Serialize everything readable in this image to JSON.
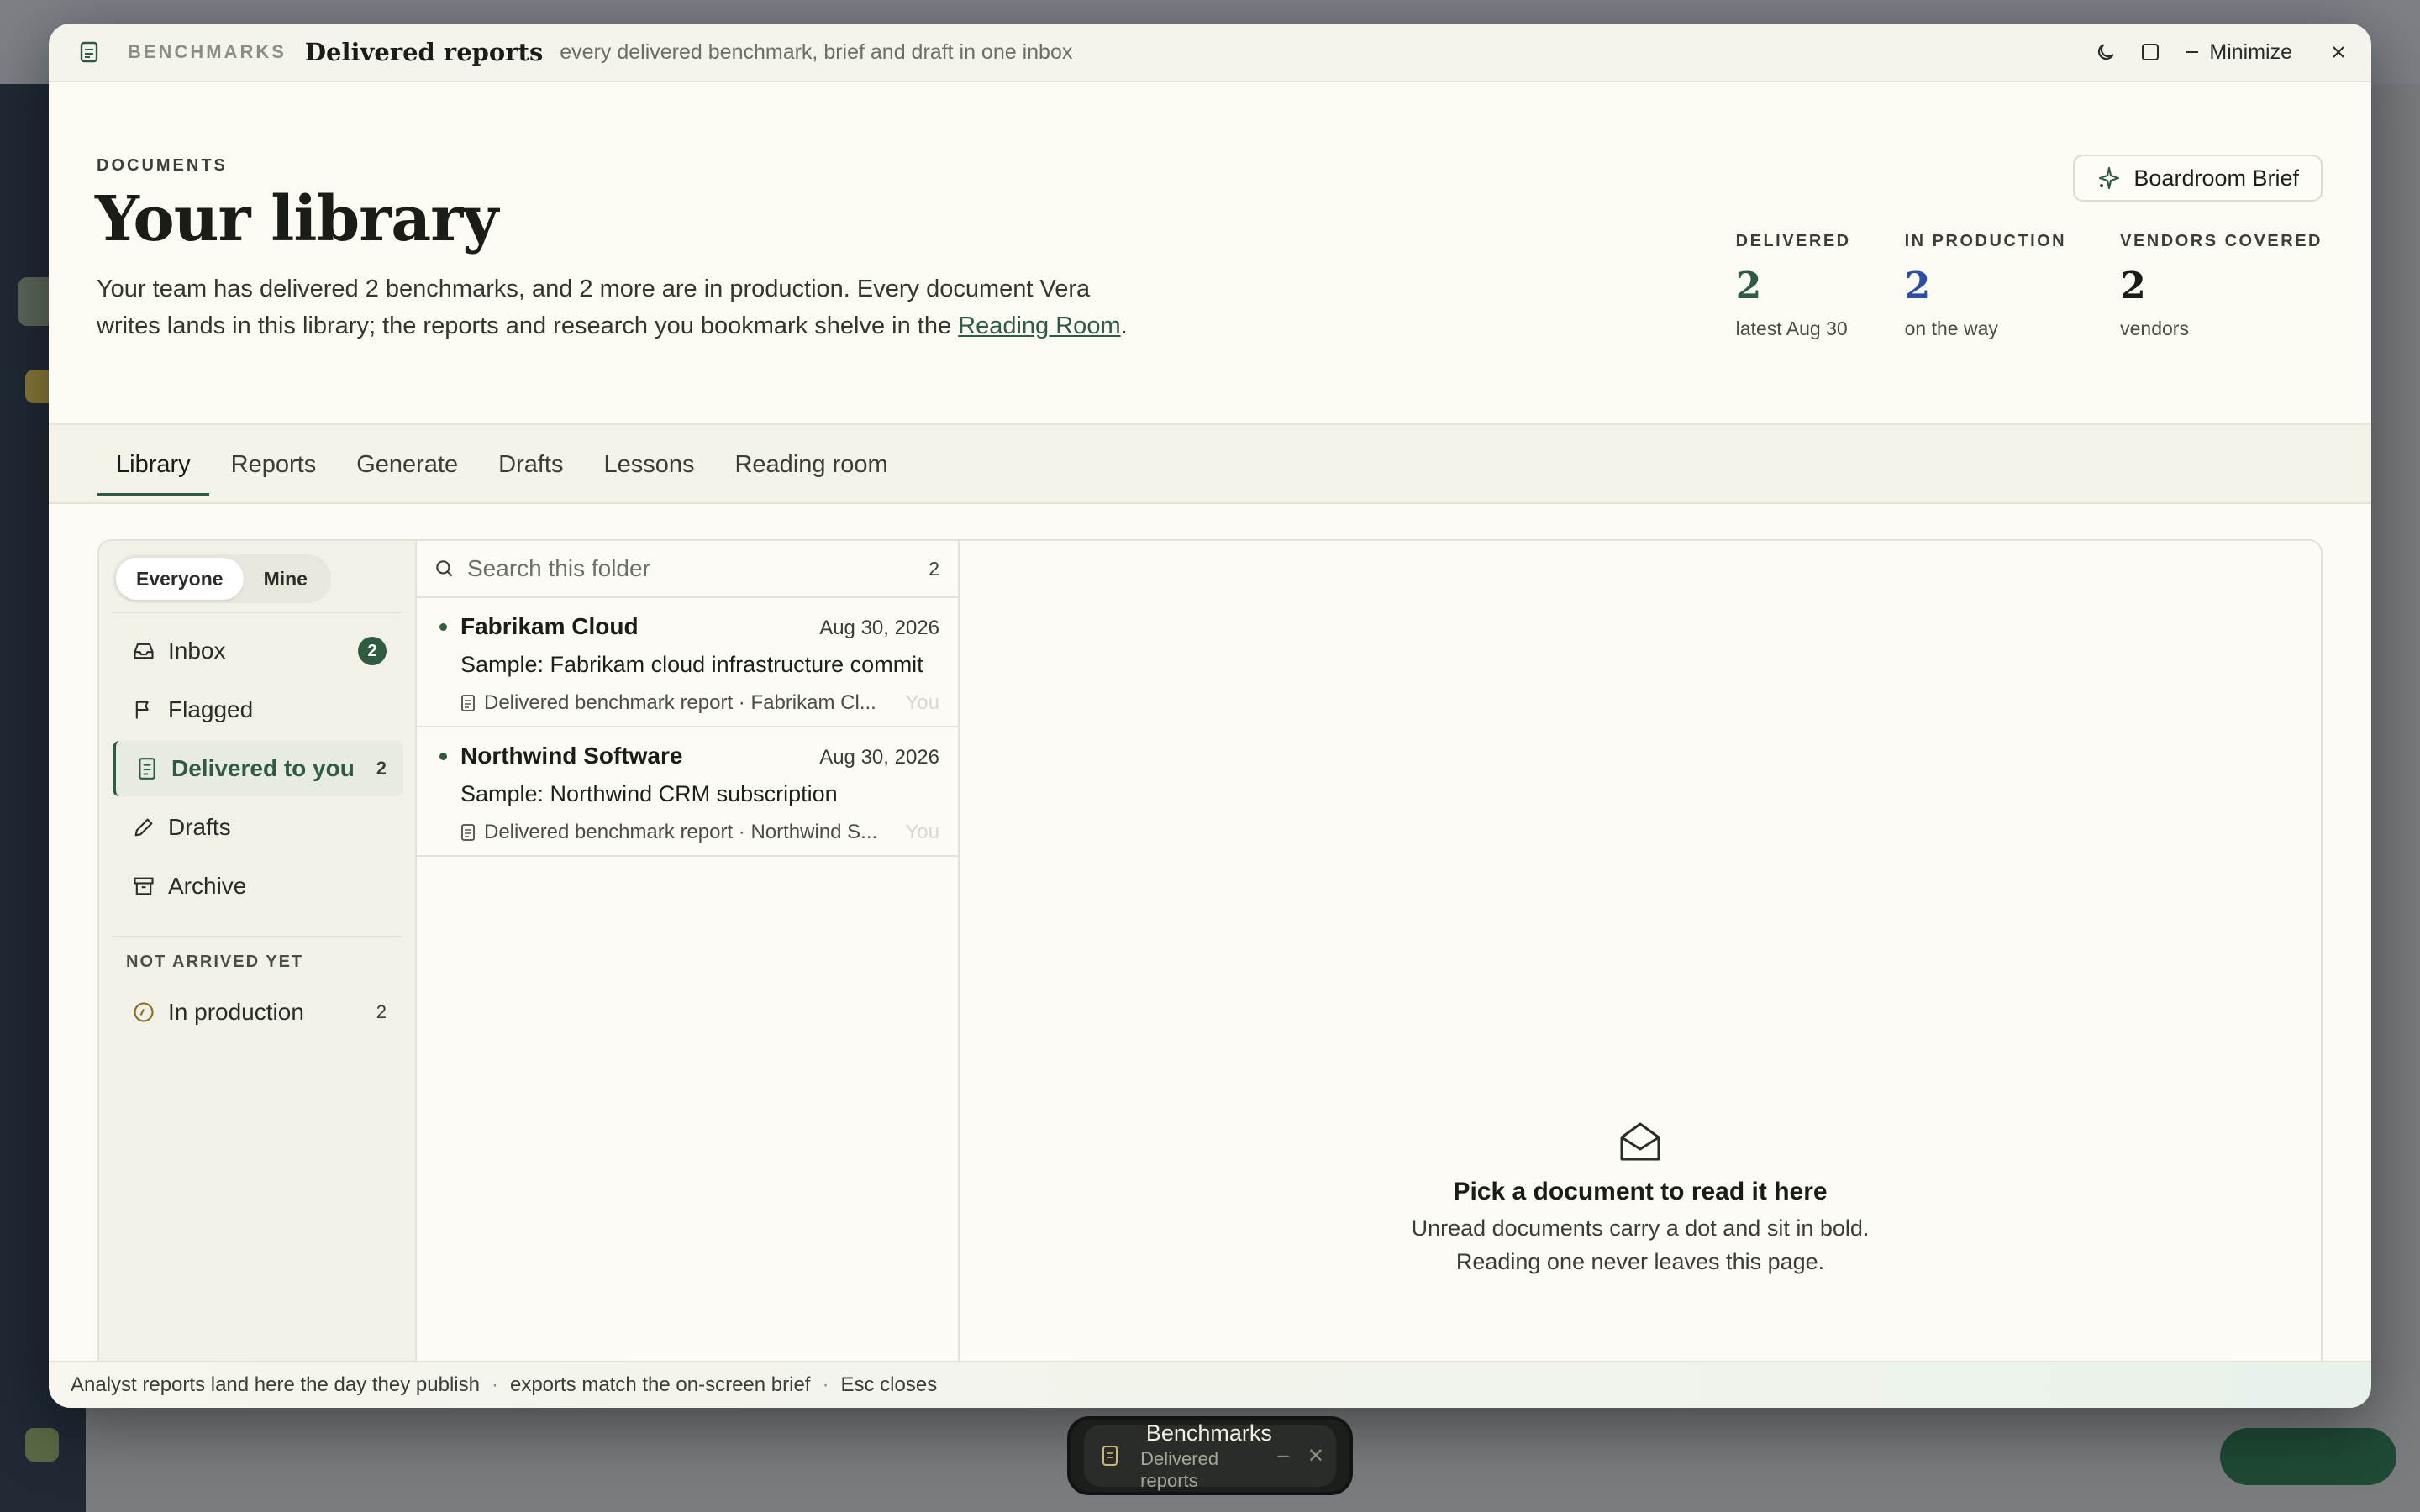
{
  "window": {
    "eyebrow": "BENCHMARKS",
    "title": "Delivered reports",
    "subtitle": "every delivered benchmark, brief and draft in one inbox",
    "minimize_label": "Minimize"
  },
  "hero": {
    "eyebrow": "DOCUMENTS",
    "title": "Your library",
    "desc_before": "Your team has delivered 2 benchmarks, and 2 more are in production. Every document Vera writes lands in this library; the reports and research you bookmark shelve in the ",
    "desc_link": "Reading Room",
    "desc_after": ".",
    "brief_button": "Boardroom Brief",
    "stats": [
      {
        "label": "DELIVERED",
        "value": "2",
        "sub": "latest Aug 30",
        "color": "#2f5c41"
      },
      {
        "label": "IN PRODUCTION",
        "value": "2",
        "sub": "on the way",
        "color": "#2d4fa3"
      },
      {
        "label": "VENDORS COVERED",
        "value": "2",
        "sub": "vendors",
        "color": "#1a1c18"
      }
    ]
  },
  "tabs": [
    "Library",
    "Reports",
    "Generate",
    "Drafts",
    "Lessons",
    "Reading room"
  ],
  "folders": {
    "segment": [
      "Everyone",
      "Mine"
    ],
    "items": [
      {
        "label": "Inbox",
        "count": "2"
      },
      {
        "label": "Flagged",
        "count": ""
      },
      {
        "label": "Delivered to you",
        "count": "2"
      },
      {
        "label": "Drafts",
        "count": ""
      },
      {
        "label": "Archive",
        "count": ""
      }
    ],
    "heading": "NOT ARRIVED YET",
    "pending": {
      "label": "In production",
      "count": "2"
    }
  },
  "list": {
    "search_placeholder": "Search this folder",
    "count": "2",
    "rows": [
      {
        "sender": "Fabrikam Cloud",
        "date": "Aug 30, 2026",
        "subject": "Sample: Fabrikam cloud infrastructure commit",
        "meta": "Delivered benchmark report · Fabrikam Cl...",
        "owner": "You"
      },
      {
        "sender": "Northwind Software",
        "date": "Aug 30, 2026",
        "subject": "Sample: Northwind CRM subscription",
        "meta": "Delivered benchmark report · Northwind S...",
        "owner": "You"
      }
    ]
  },
  "reader": {
    "title": "Pick a document to read it here",
    "line1": "Unread documents carry a dot and sit in bold.",
    "line2": "Reading one never leaves this page."
  },
  "footer": [
    "Analyst reports land here the day they publish",
    "exports match the on-screen brief",
    "Esc closes"
  ],
  "dock": {
    "title": "Benchmarks",
    "subtitle": "Delivered reports"
  },
  "colors": {
    "accent": "#2f5c41",
    "production": "#2d4fa3"
  }
}
